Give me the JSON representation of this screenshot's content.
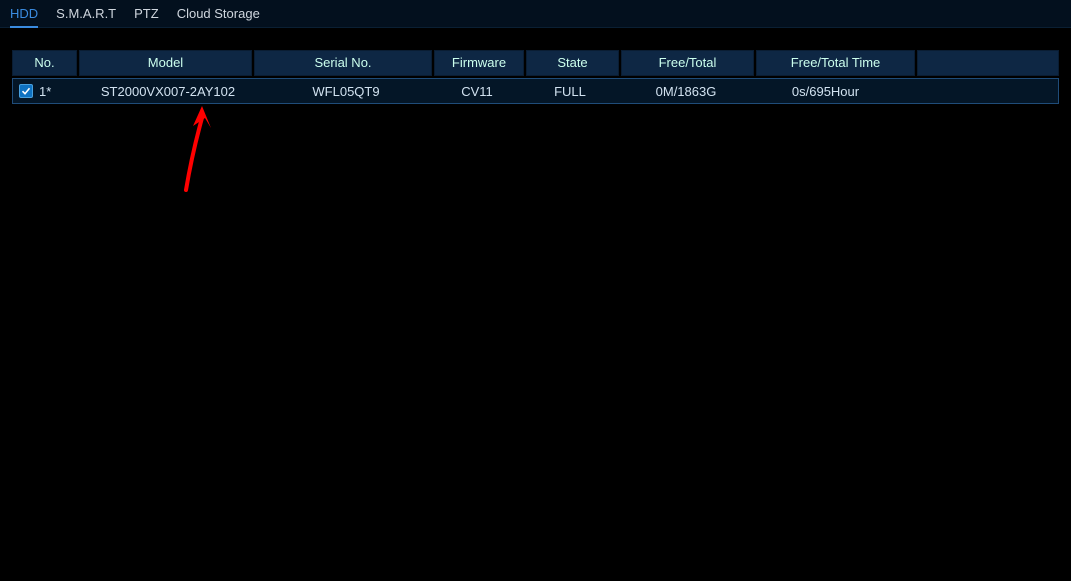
{
  "tabs": [
    {
      "label": "HDD",
      "active": true
    },
    {
      "label": "S.M.A.R.T",
      "active": false
    },
    {
      "label": "PTZ",
      "active": false
    },
    {
      "label": "Cloud Storage",
      "active": false
    }
  ],
  "columns": {
    "no": "No.",
    "model": "Model",
    "serial": "Serial No.",
    "fw": "Firmware",
    "state": "State",
    "ft": "Free/Total",
    "ftt": "Free/Total Time"
  },
  "rows": [
    {
      "checked": true,
      "no": "1*",
      "model": "ST2000VX007-2AY102",
      "serial": "WFL05QT9",
      "fw": "CV11",
      "state": "FULL",
      "ft": "0M/1863G",
      "ftt": "0s/695Hour"
    }
  ],
  "annotation": {
    "type": "arrow",
    "color": "#ff0000"
  }
}
